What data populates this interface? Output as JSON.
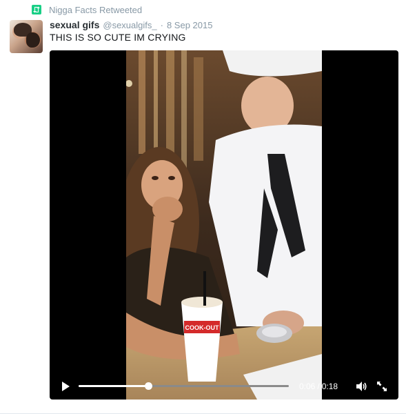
{
  "retweet": {
    "icon": "retweet-icon",
    "text": "Nigga Facts Retweeted",
    "color": "#19cf86"
  },
  "tweet": {
    "avatar": "avatar-image",
    "fullname": "sexual gifs",
    "screen_name": "@sexualgifs_",
    "separator": "·",
    "timestamp": "8 Sep 2015",
    "text": "THIS IS SO CUTE IM CRYING"
  },
  "video": {
    "progress": 0.33,
    "time_current": "0:06",
    "time_separator": "/",
    "time_total": "0:18",
    "cup_brand": "COOK-OUT",
    "play_icon": "play-icon",
    "volume_icon": "volume-icon",
    "fullscreen_icon": "fullscreen-icon"
  },
  "colors": {
    "text_primary": "#292f33",
    "text_secondary": "#8899a6",
    "background": "#f5f8fa"
  }
}
